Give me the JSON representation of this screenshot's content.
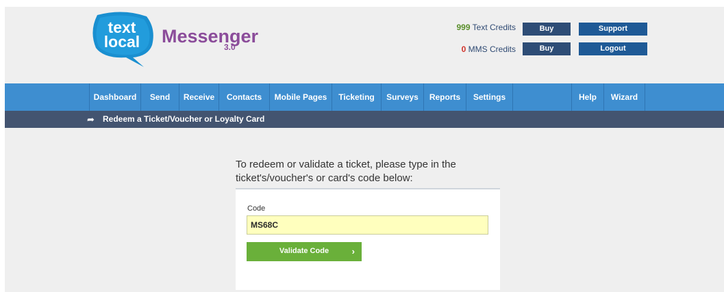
{
  "header": {
    "logo_text_line1": "text",
    "logo_text_line2": "local",
    "brand": "Messenger",
    "version": "3.0",
    "text_credits_count": "999",
    "text_credits_label": "Text Credits",
    "mms_credits_count": "0",
    "mms_credits_label": "MMS Credits",
    "buy_label": "Buy",
    "support_label": "Support",
    "logout_label": "Logout"
  },
  "nav": {
    "items": [
      "Dashboard",
      "Send",
      "Receive",
      "Contacts",
      "Mobile Pages",
      "Ticketing",
      "Surveys",
      "Reports",
      "Settings",
      "",
      "Help",
      "Wizard"
    ]
  },
  "breadcrumb": {
    "icon": "share-arrow-icon",
    "text": "Redeem a Ticket/Voucher or Loyalty Card"
  },
  "main": {
    "prompt": "To redeem or validate a ticket, please type in the ticket's/voucher's or card's code below:",
    "code_label": "Code",
    "code_value": "MS68C",
    "validate_label": "Validate Code",
    "validate_icon": "chevron-right-icon"
  },
  "colors": {
    "nav": "#3e8ed0",
    "breadcrumb": "#435470",
    "brand": "#8b4c9a",
    "validate": "#6ab03a",
    "input_highlight": "#ffffbe"
  }
}
